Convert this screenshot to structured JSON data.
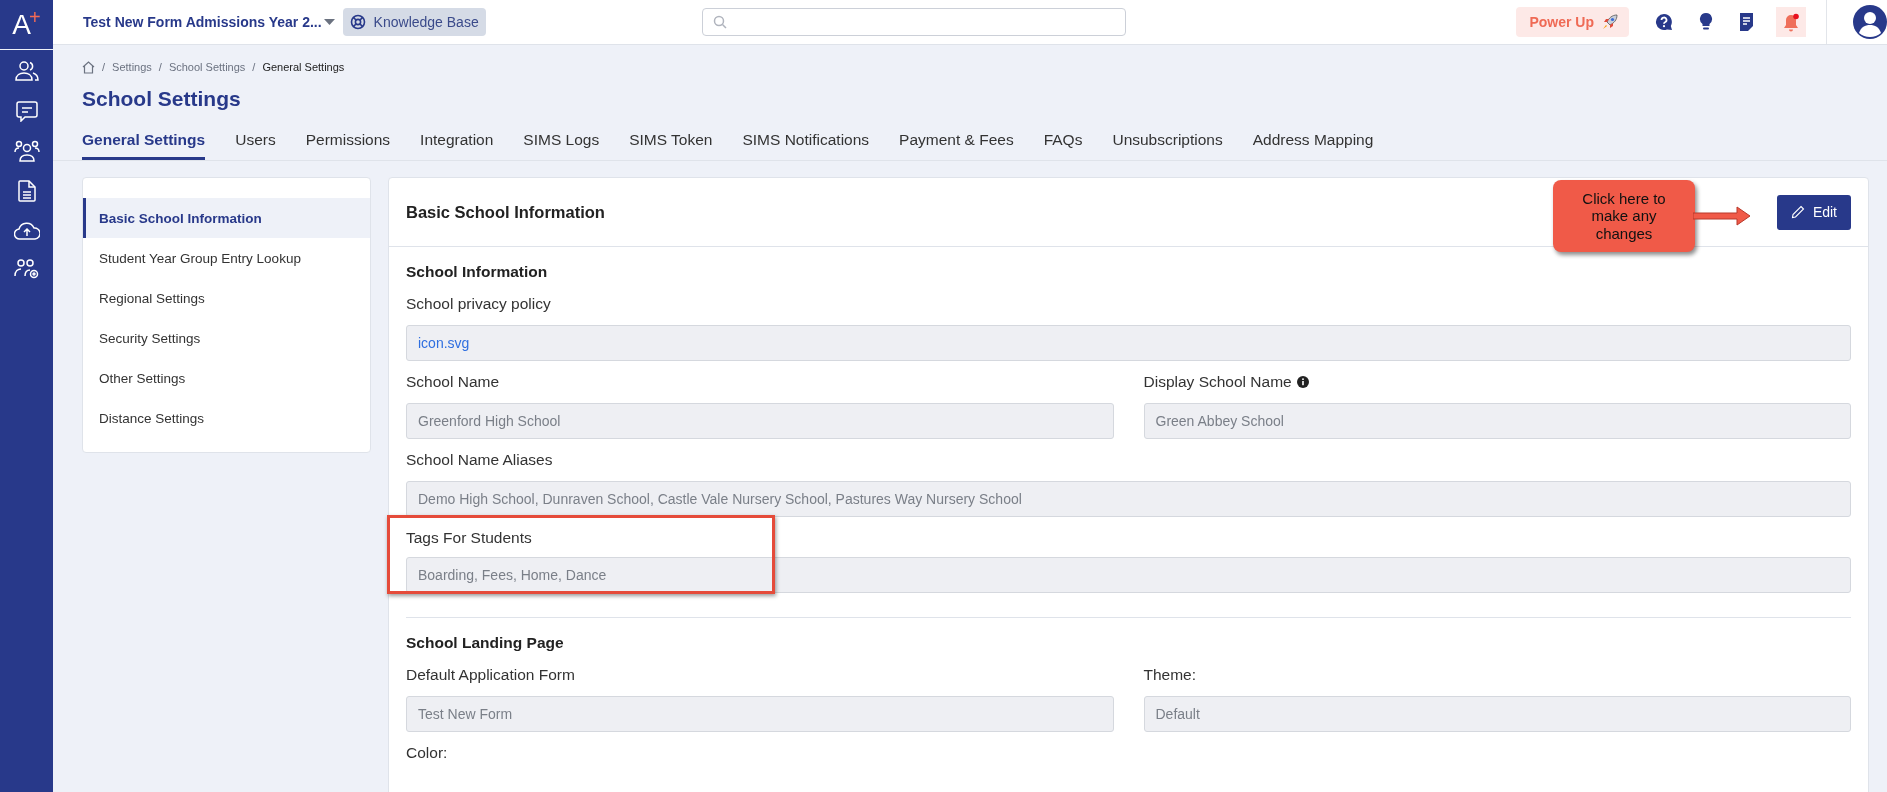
{
  "logo": {
    "letter": "A",
    "mark": "+"
  },
  "header": {
    "workspace": "Test New Form Admissions Year 2...",
    "knowledge_base": "Knowledge Base",
    "power_up": "Power Up",
    "notification_unread": true
  },
  "breadcrumb": {
    "separator": "/",
    "items": [
      "Settings",
      "School Settings",
      "General Settings"
    ]
  },
  "page_title": "School Settings",
  "tabs": [
    {
      "label": "General Settings",
      "selected": true
    },
    {
      "label": "Users",
      "selected": false
    },
    {
      "label": "Permissions",
      "selected": false
    },
    {
      "label": "Integration",
      "selected": false
    },
    {
      "label": "SIMS Logs",
      "selected": false
    },
    {
      "label": "SIMS Token",
      "selected": false
    },
    {
      "label": "SIMS Notifications",
      "selected": false
    },
    {
      "label": "Payment & Fees",
      "selected": false
    },
    {
      "label": "FAQs",
      "selected": false
    },
    {
      "label": "Unsubscriptions",
      "selected": false
    },
    {
      "label": "Address Mapping",
      "selected": false
    }
  ],
  "side_nav": [
    {
      "label": "Basic School Information",
      "selected": true
    },
    {
      "label": "Student Year Group Entry Lookup",
      "selected": false
    },
    {
      "label": "Regional Settings",
      "selected": false
    },
    {
      "label": "Security Settings",
      "selected": false
    },
    {
      "label": "Other Settings",
      "selected": false
    },
    {
      "label": "Distance Settings",
      "selected": false
    }
  ],
  "panel": {
    "title": "Basic School Information",
    "edit_button": "Edit",
    "callout": "Click here to make any changes",
    "sections": [
      {
        "title": "School Information",
        "rows": [
          [
            {
              "label": "School privacy policy",
              "value": "icon.svg",
              "kind": "link",
              "info": false,
              "highlighted": false
            }
          ],
          [
            {
              "label": "School Name",
              "value": "Greenford High School",
              "kind": "text",
              "info": false,
              "highlighted": false
            },
            {
              "label": "Display School Name",
              "value": "Green Abbey School",
              "kind": "text",
              "info": true,
              "highlighted": false
            }
          ],
          [
            {
              "label": "School Name Aliases",
              "value": "Demo High School, Dunraven School, Castle Vale Nursery School, Pastures Way Nursery School",
              "kind": "text",
              "info": false,
              "highlighted": false
            }
          ],
          [
            {
              "label": "Tags For Students",
              "value": "Boarding, Fees, Home, Dance",
              "kind": "text",
              "info": false,
              "highlighted": true
            }
          ]
        ]
      },
      {
        "title": "School Landing Page",
        "rows": [
          [
            {
              "label": "Default Application Form",
              "value": "Test New Form",
              "kind": "text",
              "info": false,
              "highlighted": false
            },
            {
              "label": "Theme:",
              "value": "Default",
              "kind": "text",
              "info": false,
              "highlighted": false
            }
          ],
          [
            {
              "label": "Color:",
              "kind": "label",
              "info": false,
              "highlighted": false
            }
          ]
        ]
      }
    ]
  }
}
